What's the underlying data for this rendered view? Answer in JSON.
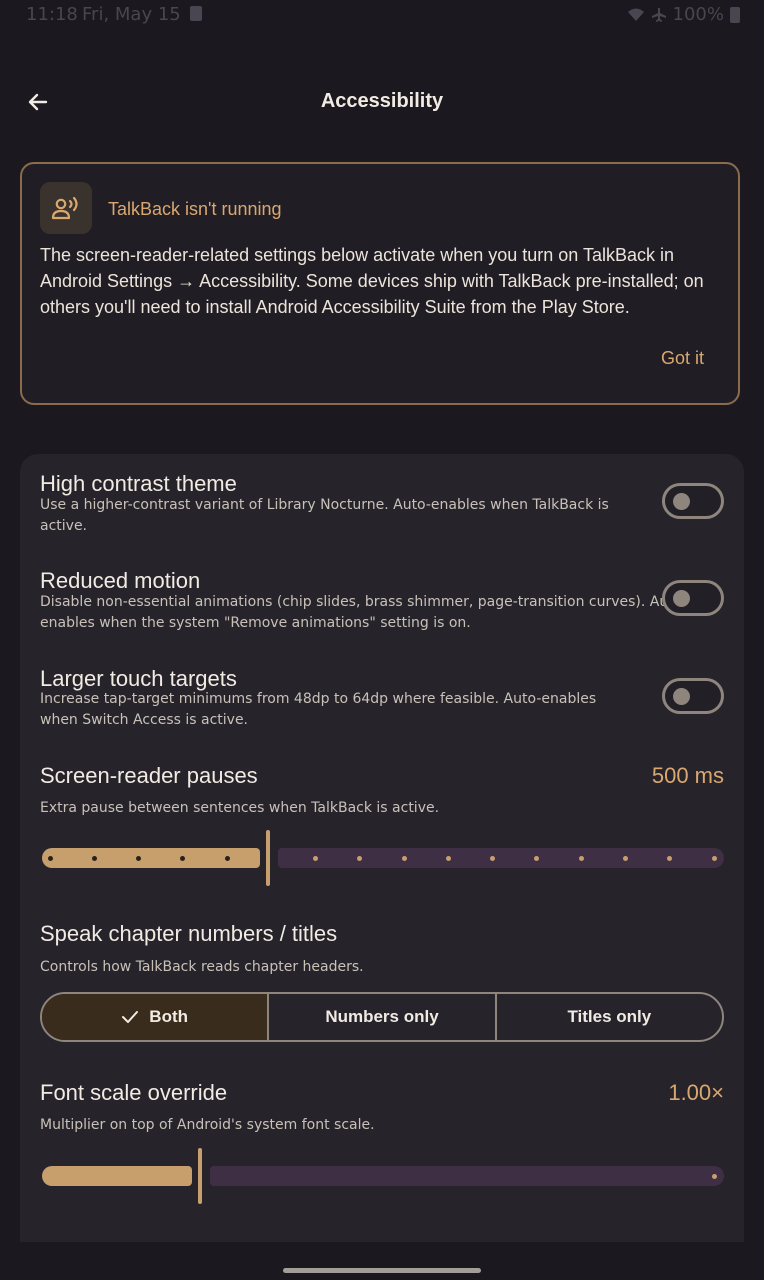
{
  "status_bar": {
    "time": "11:18",
    "date": "Fri, May 15",
    "battery": "100%"
  },
  "header": {
    "title": "Accessibility"
  },
  "notice": {
    "title": "TalkBack isn't running",
    "body": "The screen-reader-related settings below activate when you turn on TalkBack in Android Settings → Accessibility. Some devices ship with TalkBack pre-installed; on others you'll need to install Android Accessibility Suite from the Play Store.",
    "action_label": "Got it"
  },
  "settings": {
    "high_contrast": {
      "title": "High contrast theme",
      "description": "Use a higher-contrast variant of Library Nocturne. Auto-enables when TalkBack is active.",
      "enabled": false
    },
    "reduced_motion": {
      "title": "Reduced motion",
      "description": "Disable non-essential animations (chip slides, brass shimmer, page-transition curves). Auto-enables when the system \"Remove animations\" setting is on.",
      "enabled": false
    },
    "larger_targets": {
      "title": "Larger touch targets",
      "description": "Increase tap-target minimums from 48dp to 64dp where feasible. Auto-enables when Switch Access is active.",
      "enabled": false
    },
    "pauses": {
      "title": "Screen-reader pauses",
      "value_label": "500 ms",
      "description": "Extra pause between sentences when TalkBack is active.",
      "fraction": 0.333
    },
    "chapter_speech": {
      "title": "Speak chapter numbers / titles",
      "description": "Controls how TalkBack reads chapter headers.",
      "options": [
        "Both",
        "Numbers only",
        "Titles only"
      ],
      "selected": "Both"
    },
    "font_scale": {
      "title": "Font scale override",
      "value_label": "1.00×",
      "description": "Multiplier on top of Android's system font scale.",
      "fraction": 0.233
    }
  },
  "colors": {
    "accent": "#d9a870",
    "background": "#1b181f",
    "panel": "#27232b",
    "track_inactive": "#3f2f45"
  }
}
